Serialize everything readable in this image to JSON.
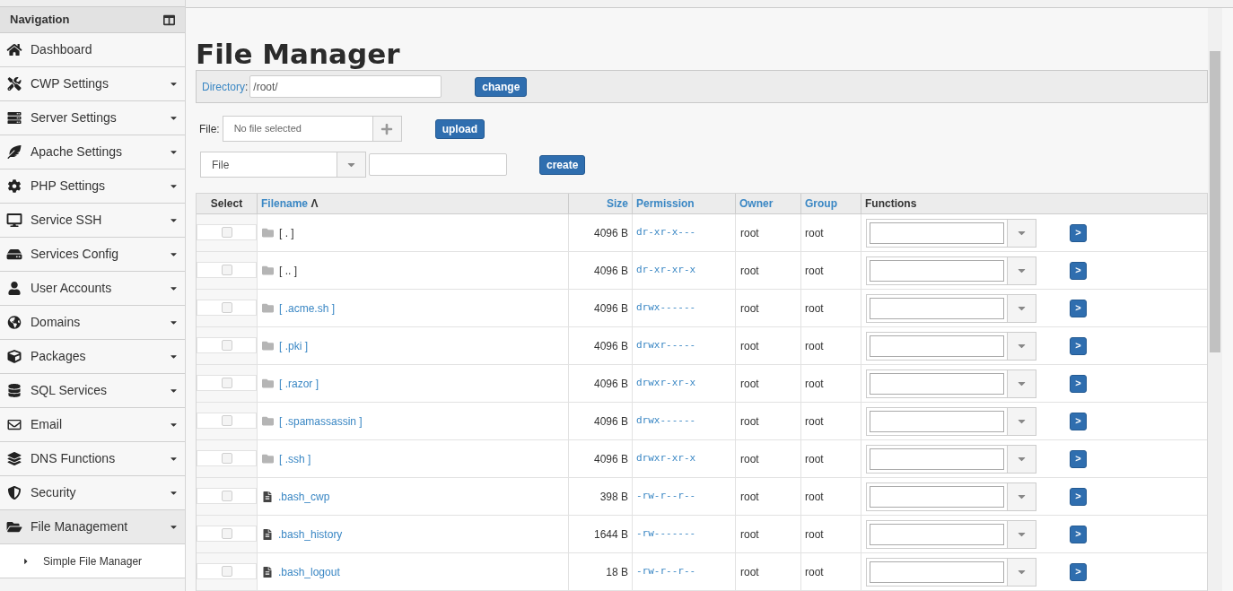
{
  "sidebar": {
    "title": "Navigation",
    "items": [
      {
        "label": "Dashboard",
        "has_menu": false,
        "expanded": false
      },
      {
        "label": "CWP Settings",
        "has_menu": true,
        "expanded": false
      },
      {
        "label": "Server Settings",
        "has_menu": true,
        "expanded": false
      },
      {
        "label": "Apache Settings",
        "has_menu": true,
        "expanded": false
      },
      {
        "label": "PHP Settings",
        "has_menu": true,
        "expanded": false
      },
      {
        "label": "Service SSH",
        "has_menu": true,
        "expanded": false
      },
      {
        "label": "Services Config",
        "has_menu": true,
        "expanded": false
      },
      {
        "label": "User Accounts",
        "has_menu": true,
        "expanded": false
      },
      {
        "label": "Domains",
        "has_menu": true,
        "expanded": false
      },
      {
        "label": "Packages",
        "has_menu": true,
        "expanded": false
      },
      {
        "label": "SQL Services",
        "has_menu": true,
        "expanded": false
      },
      {
        "label": "Email",
        "has_menu": true,
        "expanded": false
      },
      {
        "label": "DNS Functions",
        "has_menu": true,
        "expanded": false
      },
      {
        "label": "Security",
        "has_menu": true,
        "expanded": false
      },
      {
        "label": "File Management",
        "has_menu": true,
        "expanded": true,
        "children": [
          {
            "label": "Simple File Manager"
          }
        ]
      }
    ]
  },
  "title": "File Manager",
  "directory": {
    "label": "Directory",
    "colon": ":",
    "value": "/root/",
    "button": "change"
  },
  "upload": {
    "label": "File:",
    "placeholder": "No file selected",
    "button": "upload"
  },
  "create": {
    "type": "File",
    "button": "create"
  },
  "table": {
    "columns": [
      {
        "label": "Select",
        "link": false
      },
      {
        "label": "Filename",
        "link": true,
        "sort": "Λ"
      },
      {
        "label": "Size",
        "link": true
      },
      {
        "label": "Permission",
        "link": true
      },
      {
        "label": "Owner",
        "link": true
      },
      {
        "label": "Group",
        "link": true
      },
      {
        "label": "Functions",
        "link": false
      }
    ],
    "rows": [
      {
        "kind": "folder",
        "name": "[ . ]",
        "link": false,
        "size": "4096 B",
        "permission": "dr-xr-x---",
        "owner": "root",
        "group": "root",
        "checked": false,
        "go": ">"
      },
      {
        "kind": "folder",
        "name": "[ .. ]",
        "link": false,
        "size": "4096 B",
        "permission": "dr-xr-xr-x",
        "owner": "root",
        "group": "root",
        "checked": false,
        "go": ">"
      },
      {
        "kind": "folder",
        "name": "[ .acme.sh ]",
        "link": true,
        "size": "4096 B",
        "permission": "drwx------",
        "owner": "root",
        "group": "root",
        "checked": false,
        "go": ">"
      },
      {
        "kind": "folder",
        "name": "[ .pki ]",
        "link": true,
        "size": "4096 B",
        "permission": "drwxr-----",
        "owner": "root",
        "group": "root",
        "checked": false,
        "go": ">"
      },
      {
        "kind": "folder",
        "name": "[ .razor ]",
        "link": true,
        "size": "4096 B",
        "permission": "drwxr-xr-x",
        "owner": "root",
        "group": "root",
        "checked": false,
        "go": ">"
      },
      {
        "kind": "folder",
        "name": "[ .spamassassin ]",
        "link": true,
        "size": "4096 B",
        "permission": "drwx------",
        "owner": "root",
        "group": "root",
        "checked": false,
        "go": ">"
      },
      {
        "kind": "folder",
        "name": "[ .ssh ]",
        "link": true,
        "size": "4096 B",
        "permission": "drwxr-xr-x",
        "owner": "root",
        "group": "root",
        "checked": false,
        "go": ">"
      },
      {
        "kind": "file",
        "name": ".bash_cwp",
        "link": true,
        "size": "398 B",
        "permission": "-rw-r--r--",
        "owner": "root",
        "group": "root",
        "checked": false,
        "go": ">"
      },
      {
        "kind": "file",
        "name": ".bash_history",
        "link": true,
        "size": "1644 B",
        "permission": "-rw-------",
        "owner": "root",
        "group": "root",
        "checked": false,
        "go": ">"
      },
      {
        "kind": "file",
        "name": ".bash_logout",
        "link": true,
        "size": "18 B",
        "permission": "-rw-r--r--",
        "owner": "root",
        "group": "root",
        "checked": false,
        "go": ">"
      }
    ]
  }
}
